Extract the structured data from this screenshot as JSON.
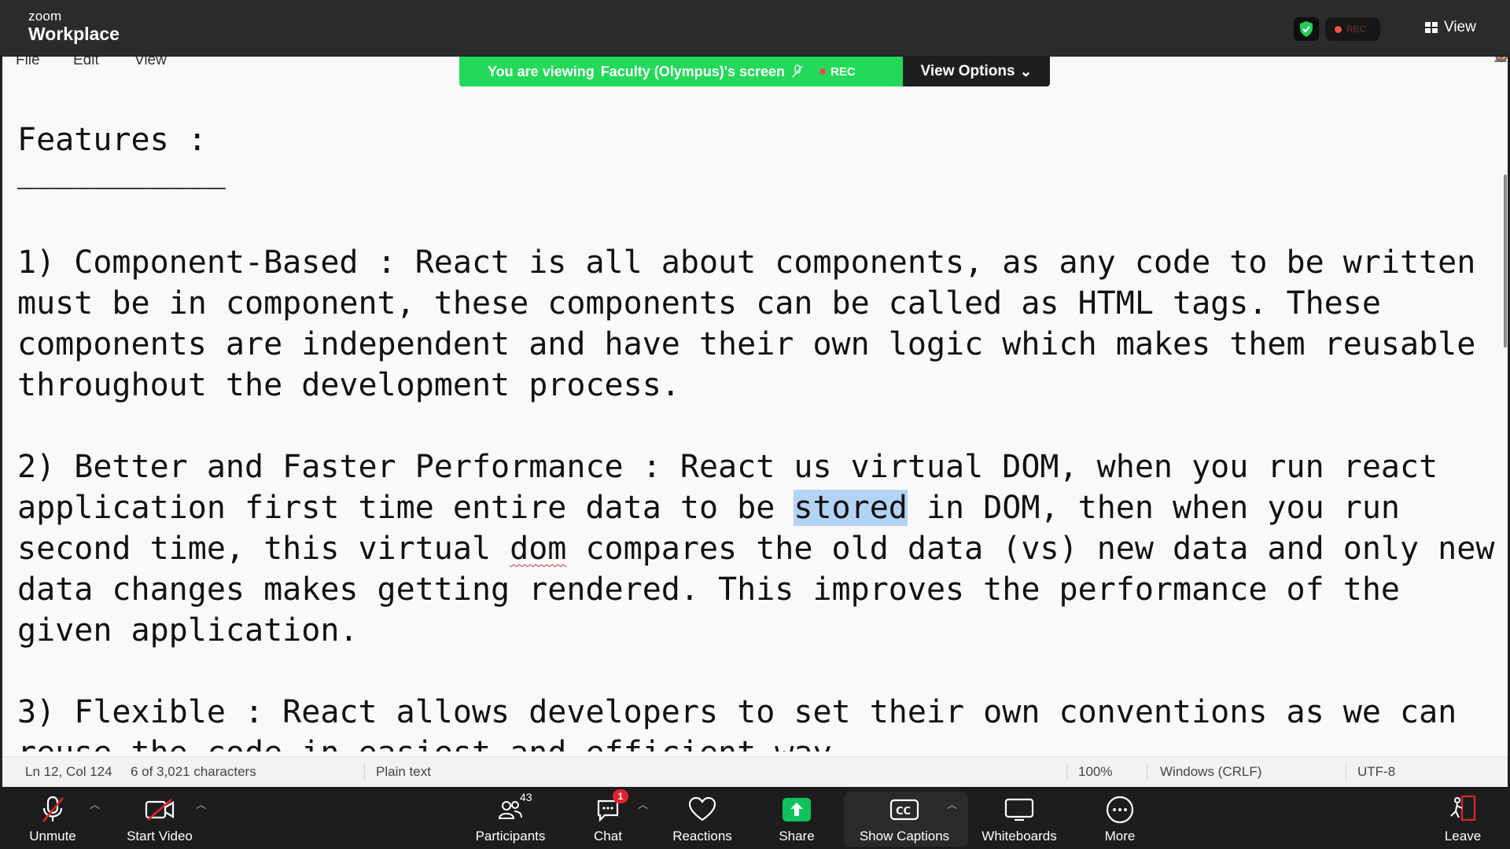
{
  "topbar": {
    "brand_small": "zoom",
    "brand_large": "Workplace",
    "rec_label": "REC",
    "view_label": "View"
  },
  "banner": {
    "prefix": "You are viewing",
    "presenter": "Faculty (Olympus)'s screen",
    "rec": "REC",
    "view_options": "View Options"
  },
  "editor": {
    "menu": [
      "File",
      "Edit",
      "View"
    ],
    "lines": {
      "l1": "Features :",
      "l2": "___________",
      "p1a": "1) Component-Based : React is all about components, as any code to be written",
      "p1b": "must be in component, these components can be called as HTML tags. These",
      "p1c": "components are independent and have their own logic which makes them reusable",
      "p1d": "throughout the development process.",
      "p2a": "2) Better and Faster Performance : React us virtual DOM, when you run react",
      "p2b_pre": "application first time entire data to be ",
      "p2b_sel": "stored",
      "p2b_post": " in DOM, then when you run",
      "p2c_pre": "second time, this virtual ",
      "p2c_err": "dom",
      "p2c_post": " compares the old data (vs) new data and only new",
      "p2d": "data changes makes getting rendered. This improves the performance of the",
      "p2e": "given application.",
      "p3a": "3) Flexible : React allows developers to set their own conventions as we can",
      "p3b": "reuse the code in easiest and efficient way."
    },
    "status": {
      "position": "Ln 12, Col 124",
      "selection": "6 of 3,021 characters",
      "format": "Plain text",
      "zoom": "100%",
      "line_endings": "Windows (CRLF)",
      "encoding": "UTF-8"
    }
  },
  "toolbar": {
    "unmute": "Unmute",
    "start_video": "Start Video",
    "participants": "Participants",
    "participants_count": "43",
    "chat": "Chat",
    "chat_badge": "1",
    "reactions": "Reactions",
    "share": "Share",
    "captions": "Show Captions",
    "whiteboards": "Whiteboards",
    "more": "More",
    "leave": "Leave"
  },
  "colors": {
    "banner_green": "#23d959",
    "share_green": "#0ec45a",
    "mute_red": "#e0232e",
    "selection": "#b3d3f4"
  }
}
